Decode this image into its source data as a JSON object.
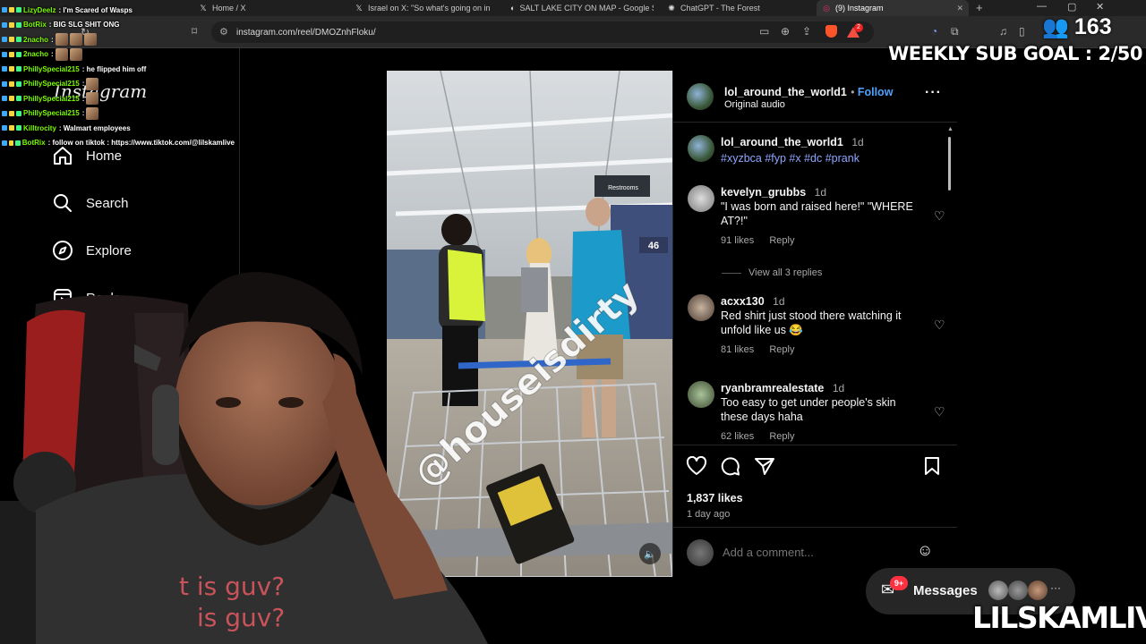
{
  "browser": {
    "tabs": [
      {
        "label": "Home / X",
        "icon": "x-logo-icon"
      },
      {
        "label": "Israel on X: \"So what's going on in",
        "icon": "x-logo-icon"
      },
      {
        "label": "SALT LAKE CITY ON MAP - Google Se",
        "icon": "google-icon"
      },
      {
        "label": "ChatGPT - The Forest",
        "icon": "chatgpt-icon"
      },
      {
        "label": "(9) Instagram",
        "icon": "instagram-icon",
        "active": true
      }
    ],
    "url": "instagram.com/reel/DMOZnhFloku/",
    "extension_badge": "2"
  },
  "chat": [
    {
      "user": "LizyDeeIz",
      "message": ": I'm Scared of Wasps",
      "color": "#7cfc00"
    },
    {
      "user": "BotRix",
      "message": ": BIG SLG SHIT ONG",
      "color": "#7cfc00"
    },
    {
      "user": "2nacho",
      "message": ":",
      "color": "#7cfc00",
      "emotes": 3
    },
    {
      "user": "2nacho",
      "message": ":",
      "color": "#7cfc00",
      "emotes": 2
    },
    {
      "user": "PhillySpecial215",
      "message": ": he flipped him off",
      "color": "#7cfc00"
    },
    {
      "user": "PhillySpecial215",
      "message": ":",
      "color": "#7cfc00",
      "emotes": 1
    },
    {
      "user": "PhillySpecial215",
      "message": ":",
      "color": "#7cfc00",
      "emotes": 1
    },
    {
      "user": "PhillySpecial215",
      "message": ":",
      "color": "#7cfc00",
      "emotes": 1
    },
    {
      "user": "Killtrocity",
      "message": ": Walmart employees",
      "color": "#7cfc00"
    },
    {
      "user": "BotRix",
      "message": ": follow on tiktok : https://www.tiktok.com/@lilskamlive",
      "color": "#7cfc00"
    }
  ],
  "sidebar": {
    "logo": "Instagram",
    "items": [
      {
        "label": "Home",
        "icon": "home-icon"
      },
      {
        "label": "Search",
        "icon": "search-icon"
      },
      {
        "label": "Explore",
        "icon": "explore-icon"
      },
      {
        "label": "Reels",
        "icon": "reels-icon"
      }
    ]
  },
  "reel": {
    "watermark": "@houseisdirty",
    "store_sign": "Restrooms",
    "aisle_number": "46"
  },
  "post": {
    "author": "lol_around_the_world1",
    "follow_label": "Follow",
    "audio": "Original audio",
    "caption_author": "lol_around_the_world1",
    "caption_time": "1d",
    "caption": "#xyzbca #fyp #x #dc #prank",
    "comments": [
      {
        "user": "kevelyn_grubbs",
        "time": "1d",
        "text": "\"I was born and raised here!\" \"WHERE AT?!\"",
        "likes": "91 likes",
        "reply": "Reply"
      },
      {
        "user": "acxx130",
        "time": "1d",
        "text": "Red shirt just stood there watching it unfold like us 😂",
        "likes": "81 likes",
        "reply": "Reply"
      },
      {
        "user": "ryanbramrealestate",
        "time": "1d",
        "text": "Too easy to get under people's skin these days haha",
        "likes": "62 likes",
        "reply": "Reply"
      }
    ],
    "view_replies": "View all 3 replies",
    "likes": "1,837 likes",
    "posted": "1 day ago",
    "comment_placeholder": "Add a comment..."
  },
  "messages": {
    "label": "Messages",
    "badge": "9+"
  },
  "stream": {
    "viewers": "163",
    "goal": "WEEKLY SUB GOAL : 2/50",
    "brand": "LILSKAMLIVE",
    "shirt_text": [
      "t is guv?",
      "is guv?"
    ]
  }
}
